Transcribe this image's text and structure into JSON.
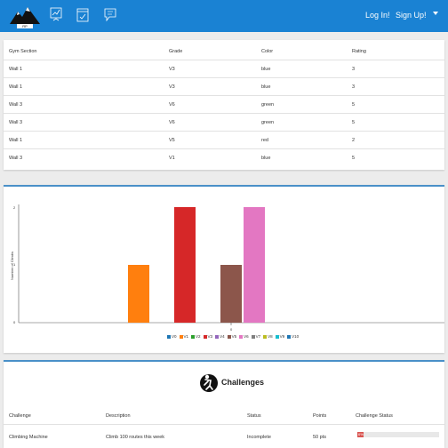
{
  "nav": {
    "log_in": "Log In!",
    "sign_up": "Sign Up!",
    "logo_text": "RP"
  },
  "routes_table": {
    "headers": [
      "Gym Section",
      "Grade",
      "Color",
      "Rating"
    ],
    "rows": [
      [
        "Wall 1",
        "V3",
        "blue",
        "3"
      ],
      [
        "Wall 1",
        "V3",
        "blue",
        "3"
      ],
      [
        "Wall 3",
        "V6",
        "green",
        "5"
      ],
      [
        "Wall 3",
        "V6",
        "green",
        "5"
      ],
      [
        "Wall 1",
        "V5",
        "red",
        "2"
      ],
      [
        "Wall 3",
        "V1",
        "blue",
        "5"
      ]
    ]
  },
  "chart_data": {
    "type": "bar",
    "categories": [
      "0"
    ],
    "ylabel": "Number of Climbs",
    "ylim": [
      0,
      2
    ],
    "yticks": [
      "0",
      "1",
      "2"
    ],
    "series": [
      {
        "name": "V0",
        "values": [
          0
        ],
        "color": "#1f77b4"
      },
      {
        "name": "V1",
        "values": [
          1
        ],
        "color": "#ff7f0e"
      },
      {
        "name": "V2",
        "values": [
          0
        ],
        "color": "#2ca02c"
      },
      {
        "name": "V3",
        "values": [
          2
        ],
        "color": "#d62728"
      },
      {
        "name": "V4",
        "values": [
          0
        ],
        "color": "#9467bd"
      },
      {
        "name": "V5",
        "values": [
          1
        ],
        "color": "#8c564b"
      },
      {
        "name": "V6",
        "values": [
          2
        ],
        "color": "#e377c2"
      },
      {
        "name": "V7",
        "values": [
          0
        ],
        "color": "#7f7f7f"
      },
      {
        "name": "V8",
        "values": [
          0
        ],
        "color": "#bcbd22"
      },
      {
        "name": "V9",
        "values": [
          0
        ],
        "color": "#17becf"
      },
      {
        "name": "V10",
        "values": [
          0
        ],
        "color": "#1f77b4"
      }
    ]
  },
  "challenges": {
    "title": "Challenges",
    "headers": [
      "Challenge",
      "Description",
      "Status",
      "Points",
      "Challenge Status"
    ],
    "rows": [
      {
        "name": "Climbing Machine",
        "description": "Climb 100 routes this week",
        "status": "Incomplete",
        "points": "50 pts",
        "progress": 0.08,
        "progress_label": "6%"
      }
    ]
  },
  "colors": {
    "navbar": "#1a82d3",
    "accent": "#4a90c8",
    "progress": "#d9534f"
  }
}
